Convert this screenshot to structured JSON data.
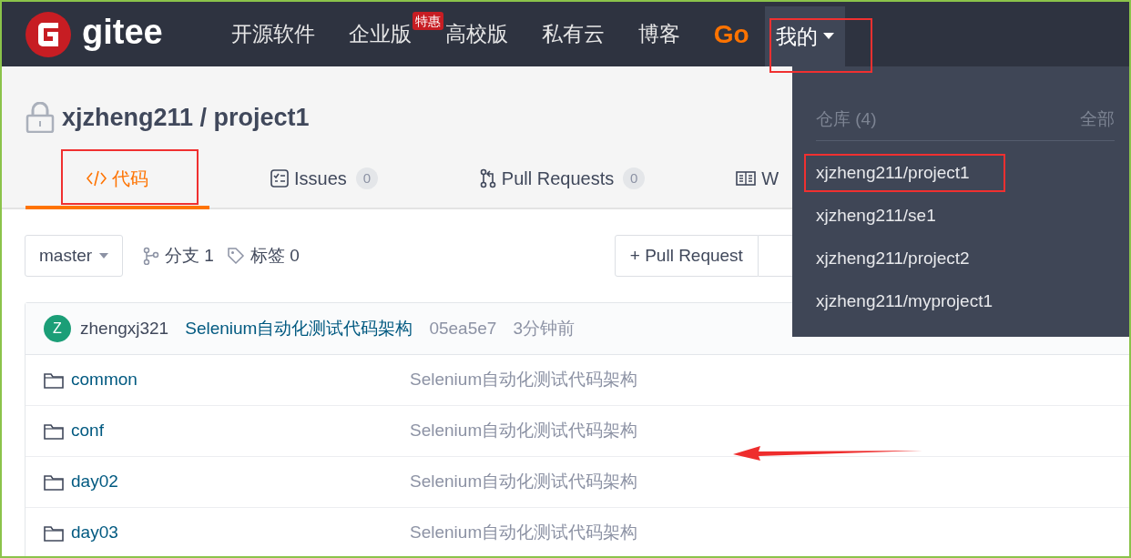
{
  "header": {
    "logo": "gitee",
    "nav": [
      {
        "label": "开源软件",
        "kind": "link",
        "highlighted": false
      },
      {
        "label": "企业版",
        "kind": "link",
        "badge": "特惠",
        "highlighted": false
      },
      {
        "label": "高校版",
        "kind": "link",
        "highlighted": false
      },
      {
        "label": "私有云",
        "kind": "link",
        "highlighted": false
      },
      {
        "label": "博客",
        "kind": "link",
        "highlighted": false
      },
      {
        "label": "Go",
        "kind": "brand",
        "highlighted": false
      },
      {
        "label": "我的",
        "kind": "menu",
        "expanded": true,
        "highlighted": true
      }
    ]
  },
  "repo": {
    "title": "xjzheng211 / project1",
    "private": true
  },
  "tabs": [
    {
      "label": "代码",
      "kind": "code",
      "selected": true,
      "highlighted": true
    },
    {
      "label": "Issues",
      "kind": "issues",
      "count": "0",
      "selected": false,
      "highlighted": false
    },
    {
      "label": "Pull Requests",
      "kind": "pulls",
      "count": "0",
      "selected": false,
      "highlighted": false
    },
    {
      "label": "W",
      "kind": "wiki",
      "selected": false,
      "highlighted": false
    }
  ],
  "toolbar": {
    "branch": "master",
    "branches": "分支 1",
    "tags": "标签 0",
    "buttons": [
      "+ Pull Request"
    ]
  },
  "commit": {
    "avatar": "Z",
    "author": "zhengxj321",
    "message": "Selenium自动化测试代码架构",
    "hash": "05ea5e7",
    "time": "3分钟前"
  },
  "files": [
    {
      "name": "common",
      "kind": "folder",
      "message": "Selenium自动化测试代码架构"
    },
    {
      "name": "conf",
      "kind": "folder",
      "message": "Selenium自动化测试代码架构"
    },
    {
      "name": "day02",
      "kind": "folder",
      "message": "Selenium自动化测试代码架构"
    },
    {
      "name": "day03",
      "kind": "folder",
      "message": "Selenium自动化测试代码架构"
    }
  ],
  "dropdown": {
    "section": "仓库 (4)",
    "all": "全部",
    "items": [
      {
        "label": "xjzheng211/project1",
        "highlighted": true
      },
      {
        "label": "xjzheng211/se1",
        "highlighted": false
      },
      {
        "label": "xjzheng211/project2",
        "highlighted": false
      },
      {
        "label": "xjzheng211/myproject1",
        "highlighted": false
      }
    ]
  }
}
